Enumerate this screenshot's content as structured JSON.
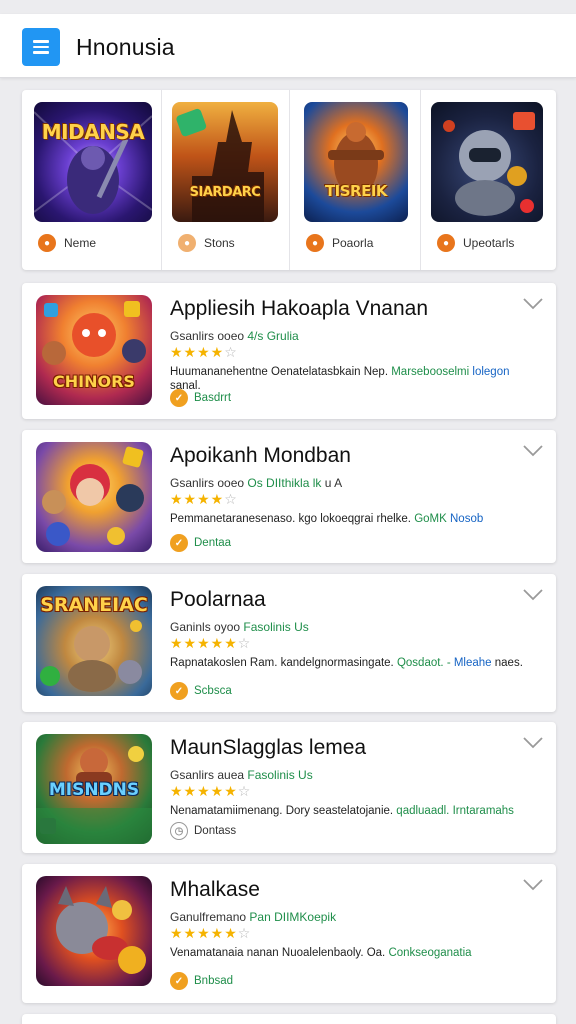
{
  "header": {
    "title": "Hnonusia"
  },
  "featured": [
    {
      "thumb_text": "MIDANSA",
      "label": "Neme",
      "badge_color": "#e8751c"
    },
    {
      "thumb_text": "SIARDARC",
      "label": "Stons",
      "badge_color": "#f0b070"
    },
    {
      "thumb_text": "TISREIK",
      "label": "Poaorla",
      "badge_color": "#e8751c"
    },
    {
      "thumb_text": "",
      "label": "Upeotarls",
      "badge_color": "#e8751c"
    }
  ],
  "apps": [
    {
      "title": "Appliesih Hakoapla Vnanan",
      "sub_plain": "Gsanlirs ooeo ",
      "sub_green": "4/s Grulia",
      "desc_plain": "Huumananehentne Oenatelatasbkain Nep. ",
      "desc_green": "Marsebooselmi ",
      "desc_blue": "lolegon",
      "desc_tail": " sanal.",
      "tag": "Basdrrt",
      "thumb_text": "CHINORS",
      "stars": "★★★★",
      "stars_empty": "☆"
    },
    {
      "title": "Apoikanh Mondban",
      "sub_plain": "Gsanlirs ooeo ",
      "sub_green": "Os DIIthikla lk",
      "sub_tail": "   u A",
      "desc_plain": "Pemmanetaranesenaso. kgo lokoeqgrai rhelke. ",
      "desc_green": "GoMK ",
      "desc_blue": "Nosob",
      "desc_tail": "",
      "tag": "Dentaa",
      "thumb_text": "",
      "stars": "★★★★",
      "stars_empty": "☆"
    },
    {
      "title": "Poolarnaa",
      "sub_plain": "Ganinls oyoo ",
      "sub_green": "Fasolinis Us",
      "desc_plain": "Rapnatakoslen Ram. kandelgnormasingate. ",
      "desc_green": "Qosdaot. - ",
      "desc_blue": "Mleahe",
      "desc_tail": " naes.",
      "tag": "Scbsca",
      "thumb_text": "SRANEIAC",
      "stars": "★★★★★",
      "stars_empty": "☆"
    },
    {
      "title": "MaunSlagglas lemea",
      "sub_plain": "Gsanlirs auea ",
      "sub_green": "Fasolinis Us",
      "desc_plain": "Nenamatamiimenang. Dory seastelatojanie. ",
      "desc_green": "qadluaadl. ",
      "desc_blue": "",
      "desc_tail": "",
      "desc_green2": "Irntaramahs",
      "tag": "Dontass",
      "tag_gray": true,
      "thumb_text": "MISNDNS",
      "stars": "★★★★★",
      "stars_empty": "☆"
    },
    {
      "title": "Mhalkase",
      "sub_plain": "Ganulfremano ",
      "sub_green": "Pan DIIMKoepik",
      "desc_plain": "Venamatanaia nanan Nuoalelenbaoly. Oa. ",
      "desc_green": "Conkseoganatia",
      "desc_blue": "",
      "desc_tail": "",
      "tag": "Bnbsad",
      "thumb_text": "",
      "stars": "★★★★★",
      "stars_empty": "☆"
    }
  ]
}
